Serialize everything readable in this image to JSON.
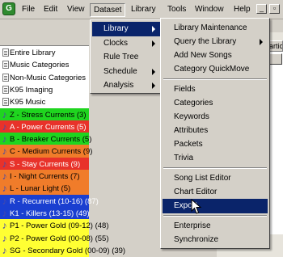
{
  "menubar": {
    "items": [
      {
        "label": "File"
      },
      {
        "label": "Edit"
      },
      {
        "label": "View"
      },
      {
        "label": "Dataset"
      },
      {
        "label": "Library"
      },
      {
        "label": "Tools"
      },
      {
        "label": "Window"
      },
      {
        "label": "Help"
      }
    ],
    "active": "Dataset"
  },
  "library_list": {
    "items": [
      {
        "label": "Entire Library",
        "color": "#ffffff",
        "icon": "library-box-icon"
      },
      {
        "label": "Music Categories",
        "color": "#ffffff",
        "icon": "library-box-icon"
      },
      {
        "label": "Non-Music Categories",
        "color": "#ffffff",
        "icon": "library-box-icon"
      },
      {
        "label": "K95 Imaging",
        "color": "#ffffff",
        "icon": "library-box-icon"
      },
      {
        "label": "K95 Music",
        "color": "#ffffff",
        "icon": "library-box-icon"
      },
      {
        "label": "Z - Stress Currents  (3)",
        "color": "#1fd51f",
        "icon": "music-note-icon"
      },
      {
        "label": "A - Power Currents  (5)",
        "color": "#e8322a",
        "icon": "music-note-icon"
      },
      {
        "label": "B - Breaker Currents  (5)",
        "color": "#1fd51f",
        "icon": "music-note-icon"
      },
      {
        "label": "C - Medium Currents  (9)",
        "color": "#f07c2a",
        "icon": "music-note-icon"
      },
      {
        "label": "S - Stay Currents  (9)",
        "color": "#e8322a",
        "icon": "music-note-icon"
      },
      {
        "label": "I - Night Currents  (7)",
        "color": "#f07c2a",
        "icon": "music-note-icon"
      },
      {
        "label": "L - Lunar Light  (5)",
        "color": "#f07c2a",
        "icon": "music-note-icon"
      },
      {
        "label": "R - Recurrent (10-16)  (87)",
        "color": "#1a3fd0",
        "icon": "music-note-icon"
      },
      {
        "label": "K1 - Killers (13-15)  (49)",
        "color": "#1a3fd0",
        "icon": "music-note-icon"
      },
      {
        "label": "P1 - Power Gold (09-12)  (48)",
        "color": "#ffff33",
        "icon": "music-note-icon"
      },
      {
        "label": "P2 - Power Gold (00-08)  (55)",
        "color": "#ffff33",
        "icon": "music-note-icon"
      },
      {
        "label": "SG - Secondary Gold (00-09)  (39)",
        "color": "#ffff33",
        "icon": "music-note-icon"
      }
    ]
  },
  "dataset_menu": {
    "items": [
      {
        "label": "Library",
        "submenu": true,
        "highlighted": true
      },
      {
        "label": "Clocks",
        "submenu": true
      },
      {
        "label": "Rule Tree",
        "submenu": false
      },
      {
        "label": "Schedule",
        "submenu": true
      },
      {
        "label": "Analysis",
        "submenu": true
      }
    ]
  },
  "library_menu": {
    "items": [
      {
        "label": "Library Maintenance"
      },
      {
        "label": "Query the Library",
        "submenu": true
      },
      {
        "label": "Add New Songs"
      },
      {
        "label": "Category QuickMove"
      },
      {
        "separator": true
      },
      {
        "label": "Fields"
      },
      {
        "label": "Categories"
      },
      {
        "label": "Keywords"
      },
      {
        "label": "Attributes"
      },
      {
        "label": "Packets"
      },
      {
        "label": "Trivia"
      },
      {
        "separator": true
      },
      {
        "label": "Song List Editor"
      },
      {
        "label": "Chart Editor"
      },
      {
        "label": "Export",
        "highlighted": true
      },
      {
        "separator": true
      },
      {
        "label": "Enterprise"
      },
      {
        "label": "Synchronize"
      }
    ]
  },
  "right_panel": {
    "column_header": "Partic"
  },
  "colors": {
    "menu_highlight": "#0a246a",
    "menu_bg": "#d4d0c8"
  }
}
